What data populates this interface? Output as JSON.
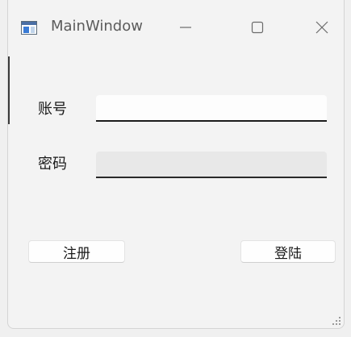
{
  "window": {
    "title": "MainWindow",
    "controls": {
      "minimize": "minimize-icon",
      "maximize": "maximize-icon",
      "close": "close-icon"
    }
  },
  "form": {
    "username": {
      "label": "账号",
      "value": "",
      "placeholder": ""
    },
    "password": {
      "label": "密码",
      "value": "",
      "placeholder": ""
    }
  },
  "actions": {
    "register_label": "注册",
    "login_label": "登陆"
  }
}
